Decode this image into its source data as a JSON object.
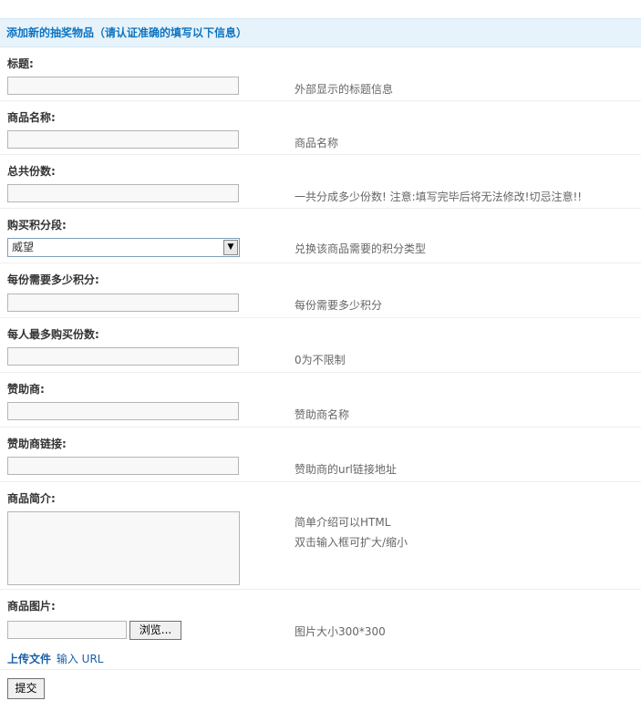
{
  "header": {
    "title": "添加新的抽奖物品（请认证准确的填写以下信息）"
  },
  "fields": {
    "title": {
      "label": "标题:",
      "value": "",
      "hint": "外部显示的标题信息"
    },
    "product_name": {
      "label": "商品名称:",
      "value": "",
      "hint": "商品名称"
    },
    "total_shares": {
      "label": "总共份数:",
      "value": "",
      "hint": "一共分成多少份数! 注意:填写完毕后将无法修改!切忌注意!!"
    },
    "points_segment": {
      "label": "购买积分段:",
      "selected": "威望",
      "hint": "兑换该商品需要的积分类型"
    },
    "points_per_share": {
      "label": "每份需要多少积分:",
      "value": "",
      "hint": "每份需要多少积分"
    },
    "max_per_person": {
      "label": "每人最多购买份数:",
      "value": "",
      "hint": "0为不限制"
    },
    "sponsor": {
      "label": "赞助商:",
      "value": "",
      "hint": "赞助商名称"
    },
    "sponsor_link": {
      "label": "赞助商链接:",
      "value": "",
      "hint": "赞助商的url链接地址"
    },
    "intro": {
      "label": "商品简介:",
      "value": "",
      "hint_line1": "简单介绍可以HTML",
      "hint_line2": "双击输入框可扩大/缩小"
    },
    "image": {
      "label": "商品图片:",
      "value": "",
      "browse_label": "浏览...",
      "hint": "图片大小300*300",
      "upload_label": "上传文件",
      "url_label": "输入 URL"
    }
  },
  "submit_label": "提交"
}
